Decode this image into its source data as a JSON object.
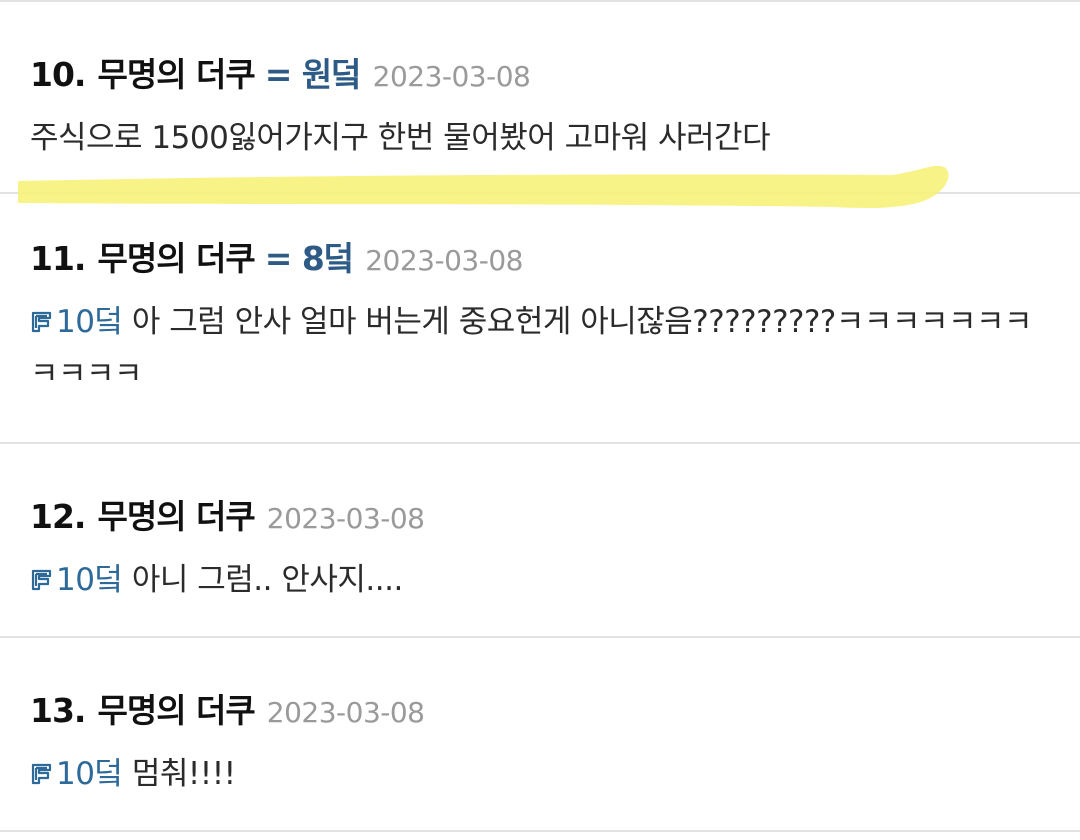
{
  "highlight_color": "#f7f27a",
  "accent_color": "#2d5b86",
  "comments": [
    {
      "number": "10.",
      "author": "무명의 더쿠",
      "tag": "= 원덬",
      "date": "2023-03-08",
      "reply_to": "",
      "text": "주식으로 1500잃어가지구 한번 물어봤어 고마워 사러간다"
    },
    {
      "number": "11.",
      "author": "무명의 더쿠",
      "tag": "= 8덬",
      "date": "2023-03-08",
      "reply_to": "10덬",
      "text": " 아 그럼 안사 얼마 버는게 중요헌게 아니잖음?????????ㅋㅋㅋㅋㅋㅋㅋㅋㅋㅋㅋ"
    },
    {
      "number": "12.",
      "author": "무명의 더쿠",
      "tag": "",
      "date": "2023-03-08",
      "reply_to": "10덬",
      "text": " 아니 그럼.. 안사지...."
    },
    {
      "number": "13.",
      "author": "무명의 더쿠",
      "tag": "",
      "date": "2023-03-08",
      "reply_to": "10덬",
      "text": " 멈춰!!!!"
    }
  ]
}
